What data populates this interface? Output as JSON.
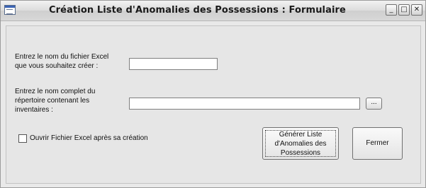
{
  "window": {
    "title": "Création Liste d'Anomalies des Possessions : Formulaire",
    "controls": {
      "minimize": "_",
      "maximize": "□",
      "close": "✕"
    },
    "icon": "form-icon"
  },
  "form": {
    "excel_label_line1": "Entrez le nom du fichier Excel",
    "excel_label_line2": "que vous souhaitez créer :",
    "excel_value": "",
    "dir_label_line1": "Entrez le nom complet du",
    "dir_label_line2": "répertoire contenant les",
    "dir_label_line3": "inventaires  :",
    "dir_value": "",
    "browse_label": "...",
    "open_excel_label": "Ouvrir Fichier Excel après sa création",
    "open_excel_checked": false,
    "generate_line1": "Générer Liste",
    "generate_line2": "d'Anomalies des",
    "generate_line3": "Possessions",
    "close_label": "Fermer"
  }
}
